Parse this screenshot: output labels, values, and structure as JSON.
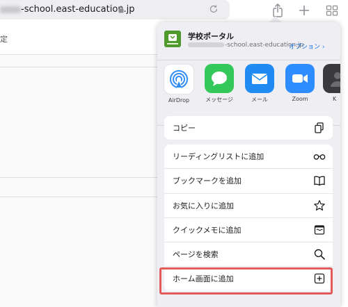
{
  "browser": {
    "url_text": "-school.east-education.jp"
  },
  "background": {
    "left_label": "定"
  },
  "share_sheet": {
    "app_title": "学校ポータル",
    "app_url": "-school.east-education.jp",
    "options_label": "オプション ›",
    "apps": [
      {
        "label": "AirDrop",
        "icon": "airdrop-icon",
        "color": "#2f8cf6"
      },
      {
        "label": "メッセージ",
        "icon": "messages-icon",
        "color": "#34c759"
      },
      {
        "label": "メール",
        "icon": "mail-icon",
        "color": "#1f8bf3"
      },
      {
        "label": "Zoom",
        "icon": "zoom-icon",
        "color": "#2d8cff"
      },
      {
        "label": "K",
        "icon": "contact-icon",
        "color": "#3a3a3c"
      }
    ],
    "copy_label": "コピー",
    "actions": [
      {
        "label": "リーディングリストに追加",
        "icon": "glasses-icon"
      },
      {
        "label": "ブックマークを追加",
        "icon": "book-icon"
      },
      {
        "label": "お気に入りに追加",
        "icon": "star-icon"
      },
      {
        "label": "クイックメモに追加",
        "icon": "quick-note-icon"
      },
      {
        "label": "ページを検索",
        "icon": "search-icon"
      },
      {
        "label": "ホーム画面に追加",
        "icon": "add-square-icon"
      }
    ],
    "highlight_color": "#e45a5a"
  }
}
